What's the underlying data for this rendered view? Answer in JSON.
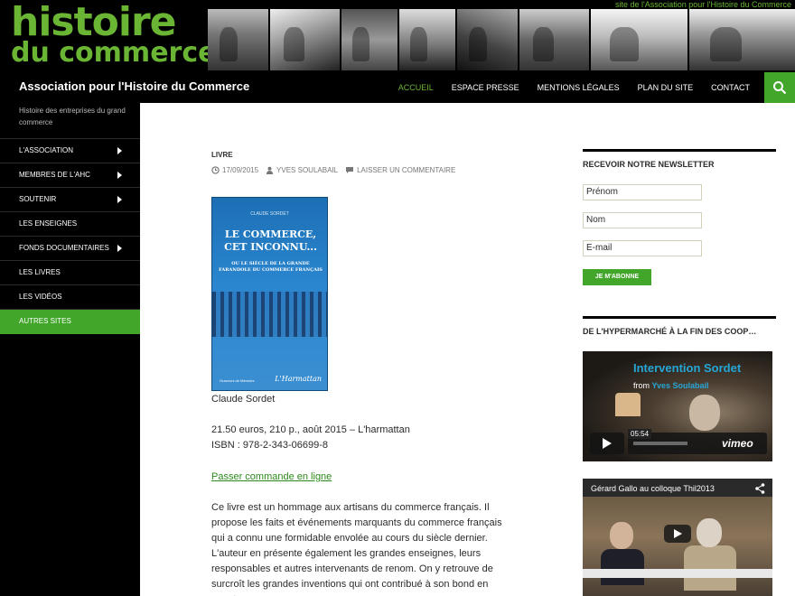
{
  "banner": {
    "logo_line1": "histoire",
    "logo_line2": "du commerce",
    "tagline": "site de l'Association pour l'Histoire du Commerce"
  },
  "header": {
    "site_title": "Association pour l'Histoire du Commerce",
    "menu": [
      {
        "label": "ACCUEIL",
        "active": true
      },
      {
        "label": "ESPACE PRESSE",
        "active": false
      },
      {
        "label": "MENTIONS LÉGALES",
        "active": false
      },
      {
        "label": "PLAN DU SITE",
        "active": false
      },
      {
        "label": "CONTACT",
        "active": false
      }
    ],
    "search_icon": "search-icon"
  },
  "sidebar": {
    "description": "Histoire des entreprises du grand commerce",
    "items": [
      {
        "label": "L'ASSOCIATION",
        "has_submenu": true
      },
      {
        "label": "MEMBRES DE L'AHC",
        "has_submenu": true
      },
      {
        "label": "SOUTENIR",
        "has_submenu": true
      },
      {
        "label": "LES ENSEIGNES",
        "has_submenu": false
      },
      {
        "label": "FONDS DOCUMENTAIRES",
        "has_submenu": true
      },
      {
        "label": "LES LIVRES",
        "has_submenu": false
      },
      {
        "label": "LES VIDÉOS",
        "has_submenu": false
      },
      {
        "label": "AUTRES SITES",
        "has_submenu": false,
        "active": true
      }
    ]
  },
  "post": {
    "category": "LIVRE",
    "date": "17/09/2015",
    "author": "YVES SOULABAIL",
    "comment_link": "LAISSER UN COMMENTAIRE",
    "cover": {
      "author": "CLAUDE SORDET",
      "title": "LE COMMERCE, CET INCONNU...",
      "subtitle": "OU LE SIÈCLE DE LA GRANDE FARANDOLE DU COMMERCE FRANÇAIS",
      "publisher": "L'Harmattan",
      "collection": "Graveurs de Mémoire"
    },
    "author_line": "Claude Sordet",
    "price_line": "21.50 euros, 210 p., août 2015 – L'harmattan",
    "isbn_line": "ISBN : 978-2-343-06699-8",
    "order_link": "Passer commande en ligne",
    "description": "Ce livre est un hommage aux artisans du commerce français. Il propose les faits et événements marquants du commerce français qui a connu une formidable envolée au cours du siècle dernier. L'auteur en présente également les grandes enseignes, leurs responsables et autres intervenants de renom. On y retrouve de surcroît les grandes inventions qui ont contribué à son bond en avant."
  },
  "newsletter": {
    "title": "RECEVOIR NOTRE NEWSLETTER",
    "prenom_placeholder": "Prénom",
    "nom_placeholder": "Nom",
    "email_placeholder": "E-mail",
    "subscribe_label": "JE M'ABONNE"
  },
  "widget2": {
    "title": "DE L'HYPERMARCHÉ À LA FIN DES COOP…",
    "vimeo": {
      "title": "Intervention Sordet",
      "from_prefix": "from",
      "from_user": "Yves Soulabail",
      "time": "05:54",
      "logo": "vimeo"
    },
    "youtube": {
      "title": "Gérard Gallo au colloque Thil2013"
    },
    "colors": {
      "accent": "#41a62a",
      "logo_green": "#6ab534",
      "vimeo_blue": "#25a6d6"
    }
  }
}
